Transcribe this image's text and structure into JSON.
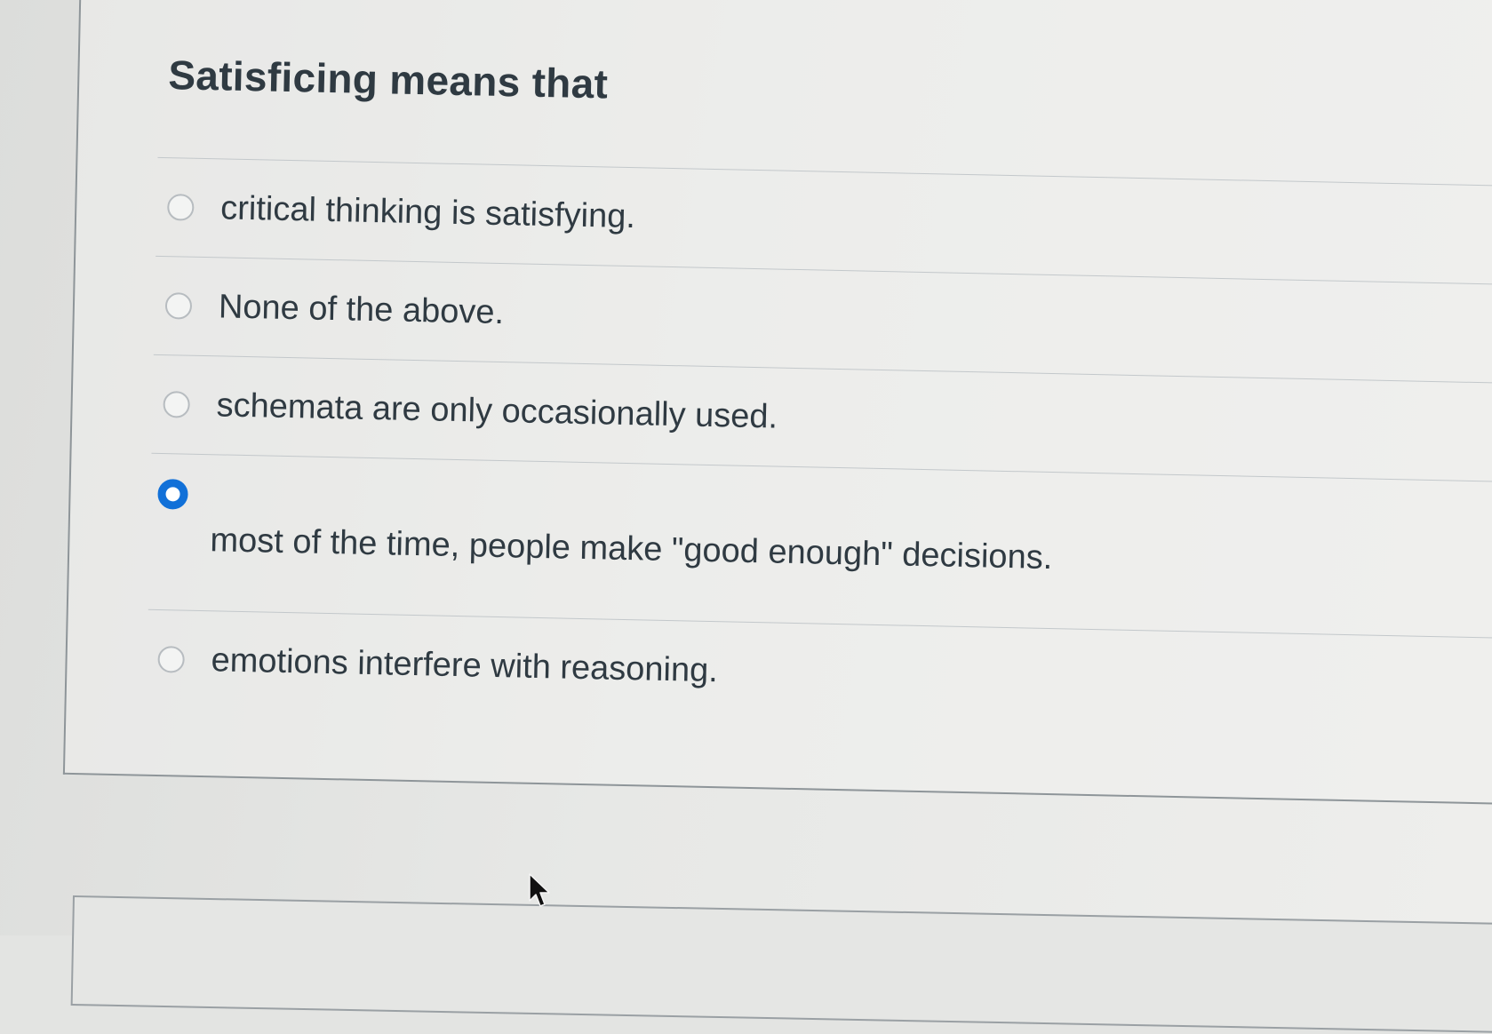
{
  "question": {
    "title": "Satisficing means that",
    "answers": [
      {
        "label": "critical thinking is satisfying.",
        "selected": false
      },
      {
        "label": "None of the above.",
        "selected": false
      },
      {
        "label": "schemata are only occasionally used.",
        "selected": false
      },
      {
        "label": "most of the time, people make \"good enough\" decisions.",
        "selected": true
      },
      {
        "label": "emotions interfere with reasoning.",
        "selected": false
      }
    ]
  },
  "colors": {
    "selected_radio": "#1170d8",
    "text": "#2f3a42",
    "divider": "#c3c8cb"
  },
  "icons": {
    "cursor": "mouse-pointer-icon",
    "radio": "radio-button-icon"
  }
}
